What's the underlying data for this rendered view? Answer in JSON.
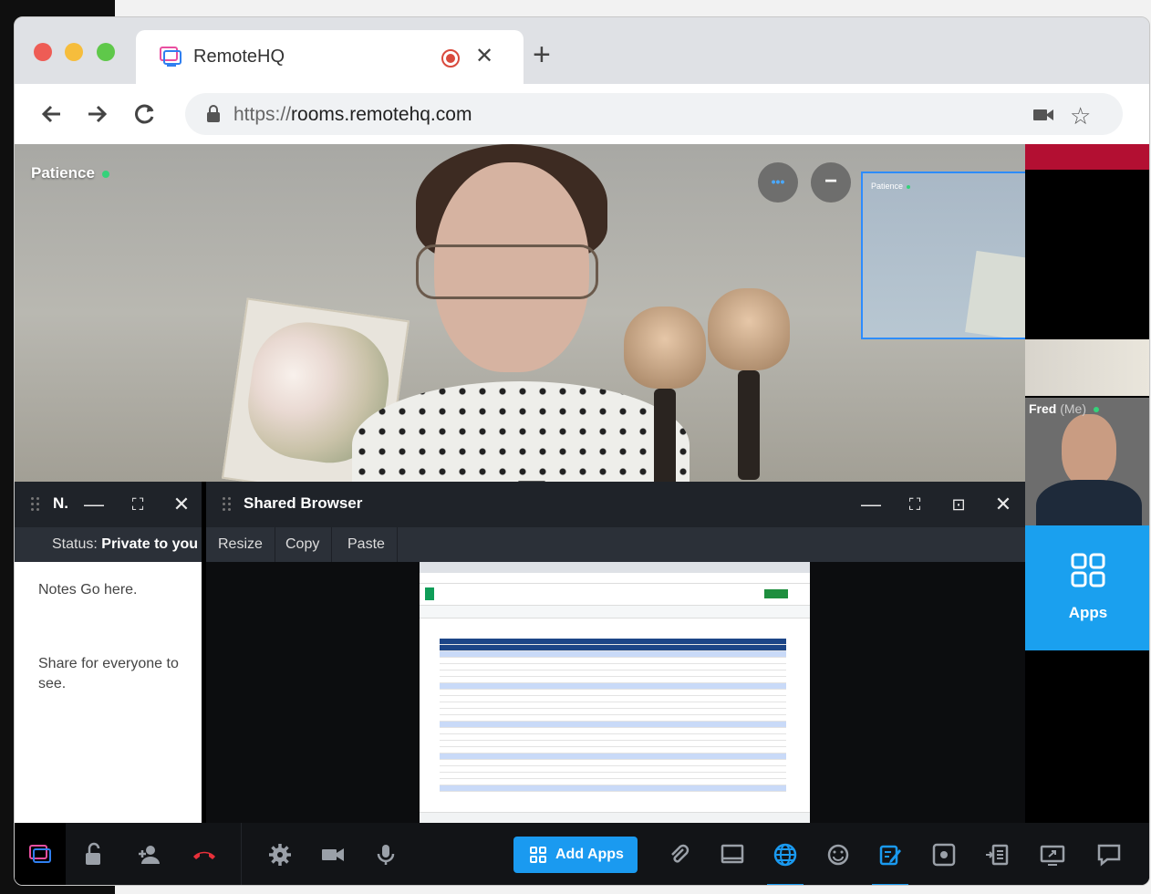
{
  "browser": {
    "tab_title": "RemoteHQ",
    "url_protocol": "https://",
    "url_host": "rooms.remotehq.com"
  },
  "video": {
    "main_participant": "Patience",
    "pip_participant": "Patience",
    "self_name": "Fred",
    "self_suffix": "(Me)",
    "more_button": "•••",
    "minimize_button": "−"
  },
  "apps_tile": {
    "label": "Apps"
  },
  "notes_panel": {
    "title": "N.",
    "status_prefix": "Status:",
    "status_value": "Private to you",
    "lines": [
      "Notes Go here.",
      "Share for everyone to see."
    ]
  },
  "browser_panel": {
    "title": "Shared Browser",
    "toolbar": [
      "Resize",
      "Copy",
      "Paste"
    ]
  },
  "bottom_bar": {
    "add_apps_label": "Add Apps"
  },
  "colors": {
    "accent": "#1aa0ef",
    "record": "#d94a3d",
    "online": "#35d27a",
    "hangup": "#e8303a"
  }
}
